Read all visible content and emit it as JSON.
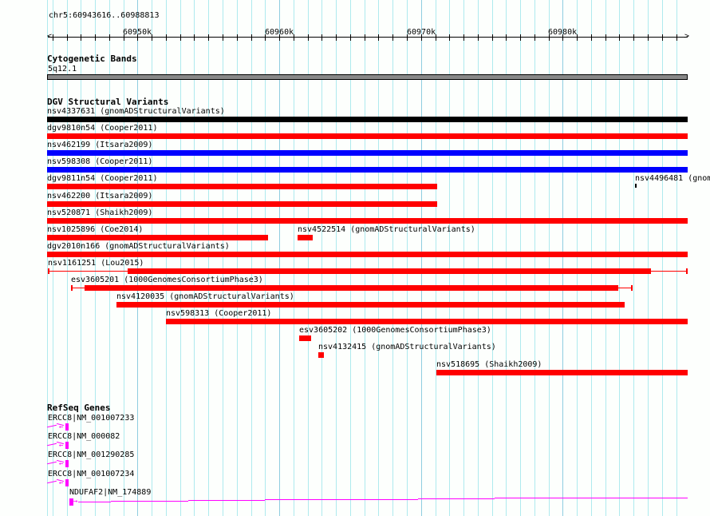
{
  "view": {
    "location": "chr5:60943616..60988813",
    "start": 60943616,
    "end": 60988813
  },
  "ruler": {
    "tick_labels": [
      {
        "label": "60950k",
        "bp": 60950000
      },
      {
        "label": "60960k",
        "bp": 60960000
      },
      {
        "label": "60970k",
        "bp": 60970000
      },
      {
        "label": "60980k",
        "bp": 60980000
      }
    ]
  },
  "colors": {
    "grid": "#aeeaee",
    "grid_major": "#8fcde0",
    "red": "#ff0000",
    "blue": "#0000ff",
    "black": "#000000",
    "band": "#888888",
    "gene": "#ff00ff"
  },
  "tracks": {
    "cytobands": {
      "title": "Cytogenetic Bands",
      "band_label": "5q12.1"
    },
    "dgv": {
      "title": "DGV Structural Variants",
      "rows": [
        [
          {
            "label": "nsv4337631 (gnomADStructuralVariants)",
            "color": "black",
            "start": 60943616,
            "end": 60988813
          }
        ],
        [
          {
            "label": "dgv9810n54 (Cooper2011)",
            "color": "red",
            "start": 60943616,
            "end": 60988813
          }
        ],
        [
          {
            "label": "nsv462199 (Itsara2009)",
            "color": "blue",
            "start": 60943616,
            "end": 60988813
          }
        ],
        [
          {
            "label": "nsv598308 (Cooper2011)",
            "color": "blue",
            "start": 60943616,
            "end": 60988813
          }
        ],
        [
          {
            "label": "dgv9811n54 (Cooper2011)",
            "color": "red",
            "start": 60943616,
            "end": 60971131
          },
          {
            "label": "nsv4496481 (gnom",
            "color": "black",
            "start": 60985100,
            "end": 60985180,
            "small": true
          }
        ],
        [
          {
            "label": "nsv462200 (Itsara2009)",
            "color": "red",
            "start": 60943616,
            "end": 60971131
          }
        ],
        [
          {
            "label": "nsv520871 (Shaikh2009)",
            "color": "red",
            "start": 60943616,
            "end": 60988813
          }
        ],
        [
          {
            "label": "nsv1025896 (Coe2014)",
            "color": "red",
            "start": 60943616,
            "end": 60959210
          },
          {
            "label": "nsv4522514 (gnomADStructuralVariants)",
            "color": "red",
            "start": 60961300,
            "end": 60962374
          }
        ],
        [
          {
            "label": "dgv2010n166 (gnomADStructuralVariants)",
            "color": "red",
            "start": 60943616,
            "end": 60988813
          }
        ],
        [
          {
            "label": "nsv1161251 (Lou2015)",
            "color": "red",
            "start": 60943650,
            "end": 60988813,
            "inner_start": 60949322,
            "inner_end": 60986217
          }
        ],
        [
          {
            "label": "esv3605201 (1000GenomesConsortiumPhase3)",
            "color": "red",
            "start": 60945310,
            "end": 60984917,
            "inner_start": 60946271,
            "inner_end": 60983900
          }
        ],
        [
          {
            "label": "nsv4120035 (gnomADStructuralVariants)",
            "color": "red",
            "start": 60948531,
            "end": 60984352
          }
        ],
        [
          {
            "label": "nsv598313 (Cooper2011)",
            "color": "red",
            "start": 60951978,
            "end": 60988813
          }
        ],
        [
          {
            "label": "esv3605202 (1000GenomesConsortiumPhase3)",
            "color": "red",
            "start": 60961413,
            "end": 60962260,
            "inner_start": 60961413,
            "inner_end": 60962204
          }
        ],
        [
          {
            "label": "nsv4132415 (gnomADStructuralVariants)",
            "color": "red",
            "start": 60962769,
            "end": 60963165
          }
        ],
        [
          {
            "label": "nsv518695 (Shaikh2009)",
            "color": "red",
            "start": 60971075,
            "end": 60988813
          }
        ]
      ]
    },
    "refseq": {
      "title": "RefSeq Genes",
      "genes": [
        {
          "label": "ERCC8|NM_001007233",
          "strand": "-"
        },
        {
          "label": "ERCC8|NM_000082",
          "strand": "-"
        },
        {
          "label": "ERCC8|NM_001290285",
          "strand": "-"
        },
        {
          "label": "ERCC8|NM_001007234",
          "strand": "-"
        },
        {
          "label": "NDUFAF2|NM_174889",
          "strand": "+"
        }
      ]
    }
  }
}
